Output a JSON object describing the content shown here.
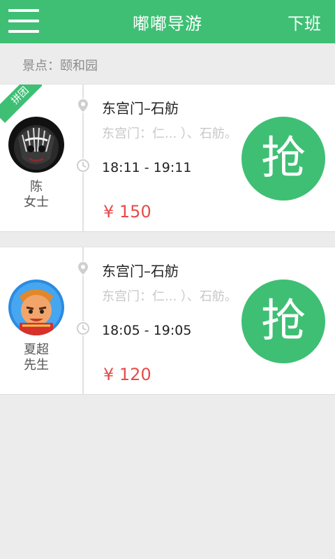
{
  "header": {
    "title": "嘟嘟导游",
    "right_action": "下班",
    "menu_icon": "hamburger-menu-icon",
    "bg_color": "#3fbf74"
  },
  "spot": {
    "label": "景点：颐和园"
  },
  "orders": [
    {
      "badge": "拼团",
      "name_line1": "陈",
      "name_line2": "女士",
      "route": "东宫门–石舫",
      "route_detail": "东宫门：仁... ）、石舫。",
      "time": "18:11 - 19:11",
      "price": "¥ 150",
      "grab_label": "抢"
    },
    {
      "badge": "",
      "name_line1": "夏超",
      "name_line2": "先生",
      "route": "东宫门–石舫",
      "route_detail": "东宫门：仁... ）、石舫。",
      "time": "18:05 - 19:05",
      "price": "¥ 120",
      "grab_label": "抢"
    }
  ],
  "colors": {
    "accent": "#3fbf74",
    "price": "#e84b4b"
  }
}
